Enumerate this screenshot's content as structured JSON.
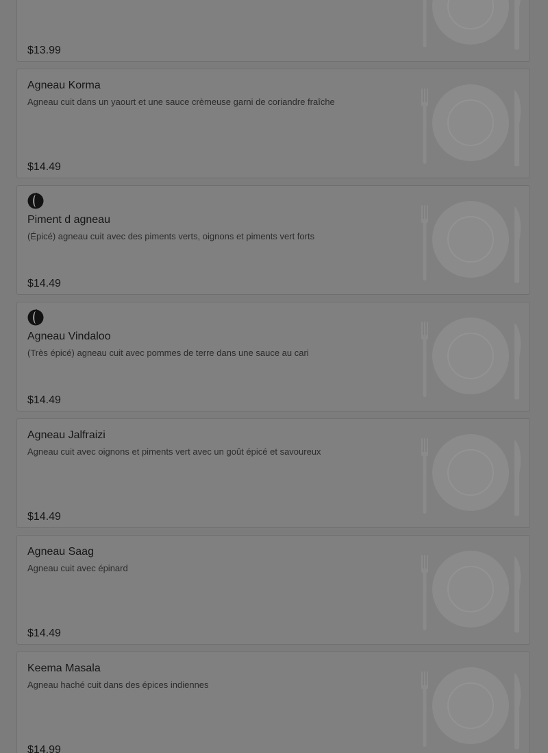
{
  "items": [
    {
      "name": "",
      "description": "",
      "price": "$13.99",
      "spicy": false
    },
    {
      "name": "Agneau Korma",
      "description": "Agneau cuit dans un yaourt et une sauce crèmeuse garni de coriandre fraîche",
      "price": "$14.49",
      "spicy": false
    },
    {
      "name": "Piment d agneau",
      "description": "(Épicé) agneau cuit avec des piments verts, oignons et piments vert forts",
      "price": "$14.49",
      "spicy": true
    },
    {
      "name": "Agneau Vindaloo",
      "description": "(Très épicé) agneau cuit avec pommes de terre dans une sauce au cari",
      "price": "$14.49",
      "spicy": true
    },
    {
      "name": "Agneau Jalfraizi",
      "description": "Agneau cuit avec oignons et piments vert avec un goût épicé et savoureux",
      "price": "$14.49",
      "spicy": false
    },
    {
      "name": "Agneau Saag",
      "description": "Agneau cuit avec épinard",
      "price": "$14.49",
      "spicy": false
    },
    {
      "name": "Keema Masala",
      "description": "Agneau haché cuit dans des épices indiennes",
      "price": "$14.99",
      "spicy": false
    }
  ],
  "icons": {
    "spicy": "chili-pepper-icon",
    "placeholder": "plate-cutlery-icon"
  },
  "colors": {
    "overlay": "#7c7c7c",
    "card": "#808080",
    "text": "#161616"
  }
}
